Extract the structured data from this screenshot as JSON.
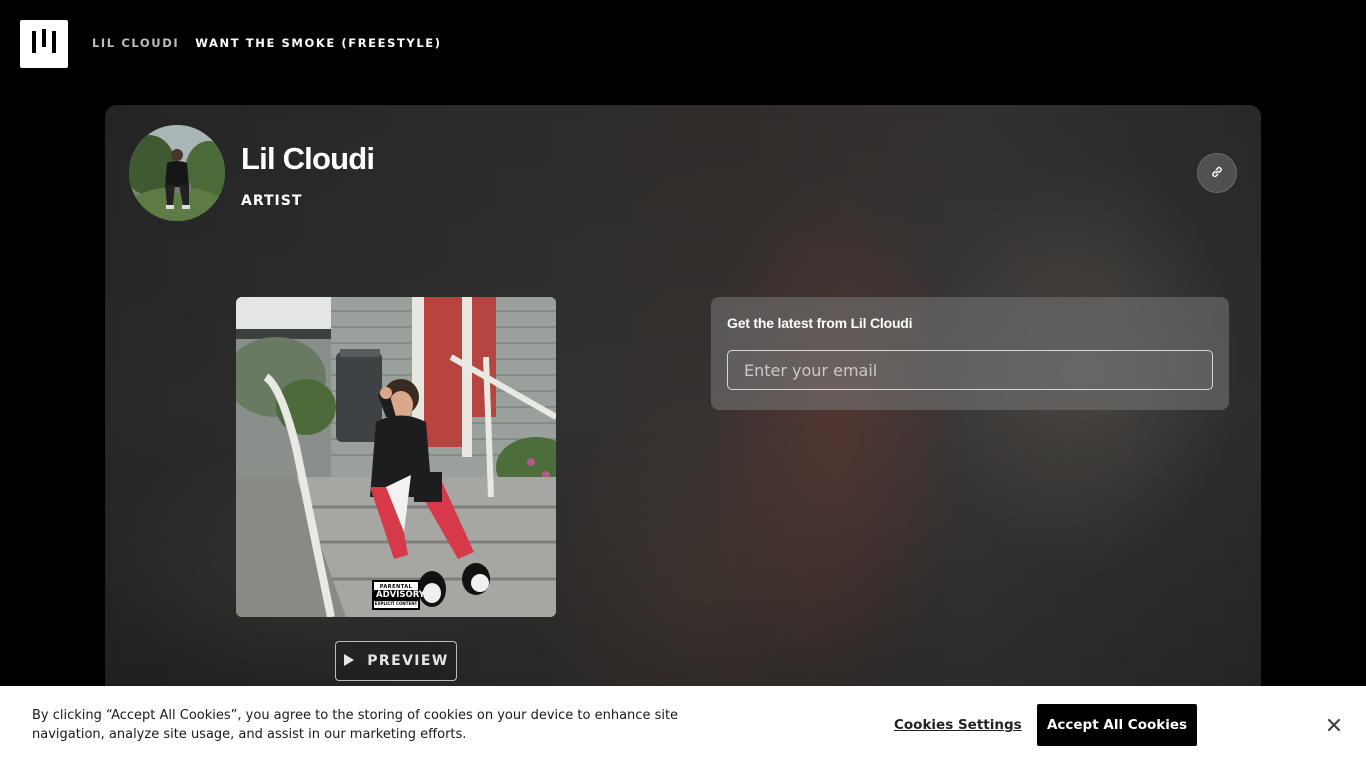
{
  "header": {
    "logo_icon": "bars-logo-icon",
    "breadcrumb": {
      "artist": "LIL CLOUDI",
      "track": "WANT THE SMOKE (FREESTYLE)"
    }
  },
  "artist": {
    "name": "Lil Cloudi",
    "role": "ARTIST",
    "link_icon": "link-icon"
  },
  "release": {
    "advisory": {
      "line1": "PARENTAL",
      "line2": "ADVISORY",
      "line3": "EXPLICIT CONTENT"
    },
    "preview_label": "PREVIEW",
    "preview_icon": "play-icon"
  },
  "signup": {
    "title": "Get the latest from Lil Cloudi",
    "email_placeholder": "Enter your email"
  },
  "cookie_banner": {
    "text": "By clicking “Accept All Cookies”, you agree to the storing of cookies on your device to enhance site navigation, analyze site usage, and assist in our marketing efforts.",
    "settings_label": "Cookies Settings",
    "accept_label": "Accept All Cookies",
    "close_icon": "close-icon"
  },
  "colors": {
    "background": "#000000",
    "card": "#2c2c2c",
    "accent_pants": "#d63a4a"
  }
}
